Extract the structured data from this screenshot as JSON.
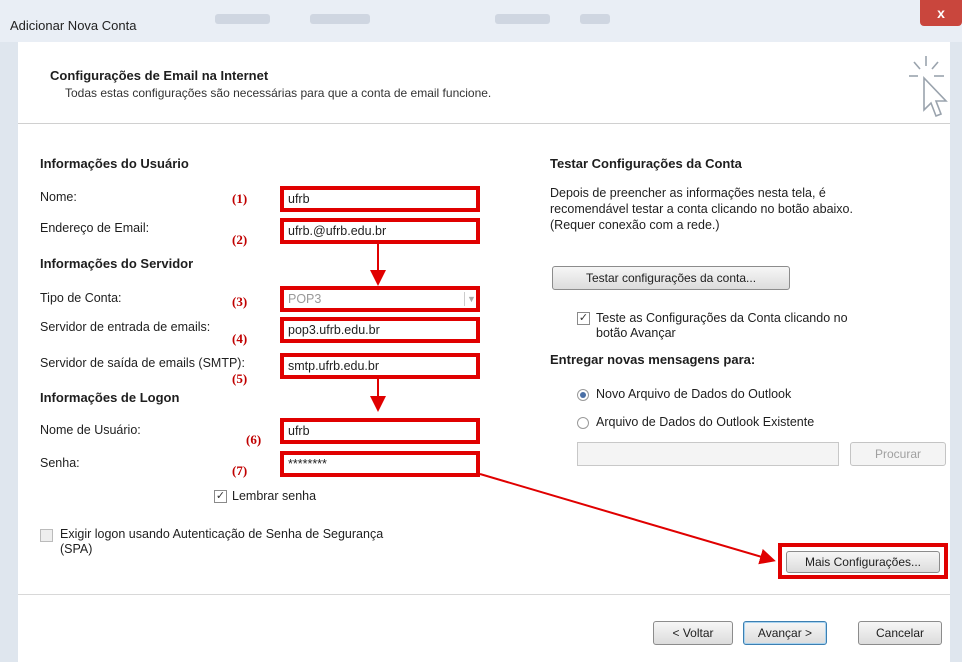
{
  "window": {
    "title": "Adicionar Nova Conta",
    "close_glyph": "x"
  },
  "header": {
    "title": "Configurações de Email na Internet",
    "subtitle": "Todas estas configurações são necessárias para que a conta de email funcione."
  },
  "user_info": {
    "heading": "Informações do Usuário",
    "name_label": "Nome:",
    "name_value": "ufrb",
    "email_label": "Endereço de Email:",
    "email_value": "ufrb.@ufrb.edu.br"
  },
  "server_info": {
    "heading": "Informações do Servidor",
    "account_type_label": "Tipo de Conta:",
    "account_type_value": "POP3",
    "incoming_label": "Servidor de entrada de emails:",
    "incoming_value": "pop3.ufrb.edu.br",
    "outgoing_label": "Servidor de saída de emails (SMTP):",
    "outgoing_value": "smtp.ufrb.edu.br"
  },
  "logon_info": {
    "heading": "Informações de Logon",
    "username_label": "Nome de Usuário:",
    "username_value": "ufrb",
    "password_label": "Senha:",
    "password_value": "********",
    "remember_label": "Lembrar senha",
    "remember_checked": true,
    "spa_label_line1": "Exigir logon usando Autenticação de Senha de Segurança",
    "spa_label_line2": "(SPA)",
    "spa_checked": false
  },
  "annotations": {
    "markers": [
      "(1)",
      "(2)",
      "(3)",
      "(4)",
      "(5)",
      "(6)",
      "(7)"
    ],
    "highlight_color": "#e00000"
  },
  "test_settings": {
    "heading": "Testar Configurações da Conta",
    "description_line1": "Depois de preencher as informações nesta tela, é",
    "description_line2": "recomendável testar a conta clicando no botão abaixo.",
    "description_line3": "(Requer conexão com a rede.)",
    "test_button": "Testar configurações da conta...",
    "auto_test_line1": "Teste as Configurações da Conta clicando no",
    "auto_test_line2": "botão Avançar",
    "auto_test_checked": true
  },
  "deliver": {
    "heading": "Entregar novas mensagens para:",
    "option_new": "Novo Arquivo de Dados do Outlook",
    "option_existing": "Arquivo de Dados do Outlook Existente",
    "selected": "option_new",
    "browse_button": "Procurar"
  },
  "more_settings_button": "Mais Configurações...",
  "footer": {
    "back_button": "< Voltar",
    "next_button": "Avançar >",
    "cancel_button": "Cancelar"
  },
  "colors": {
    "accent": "#e00000",
    "title_bar": "#e9eef5",
    "close": "#c9463d"
  }
}
